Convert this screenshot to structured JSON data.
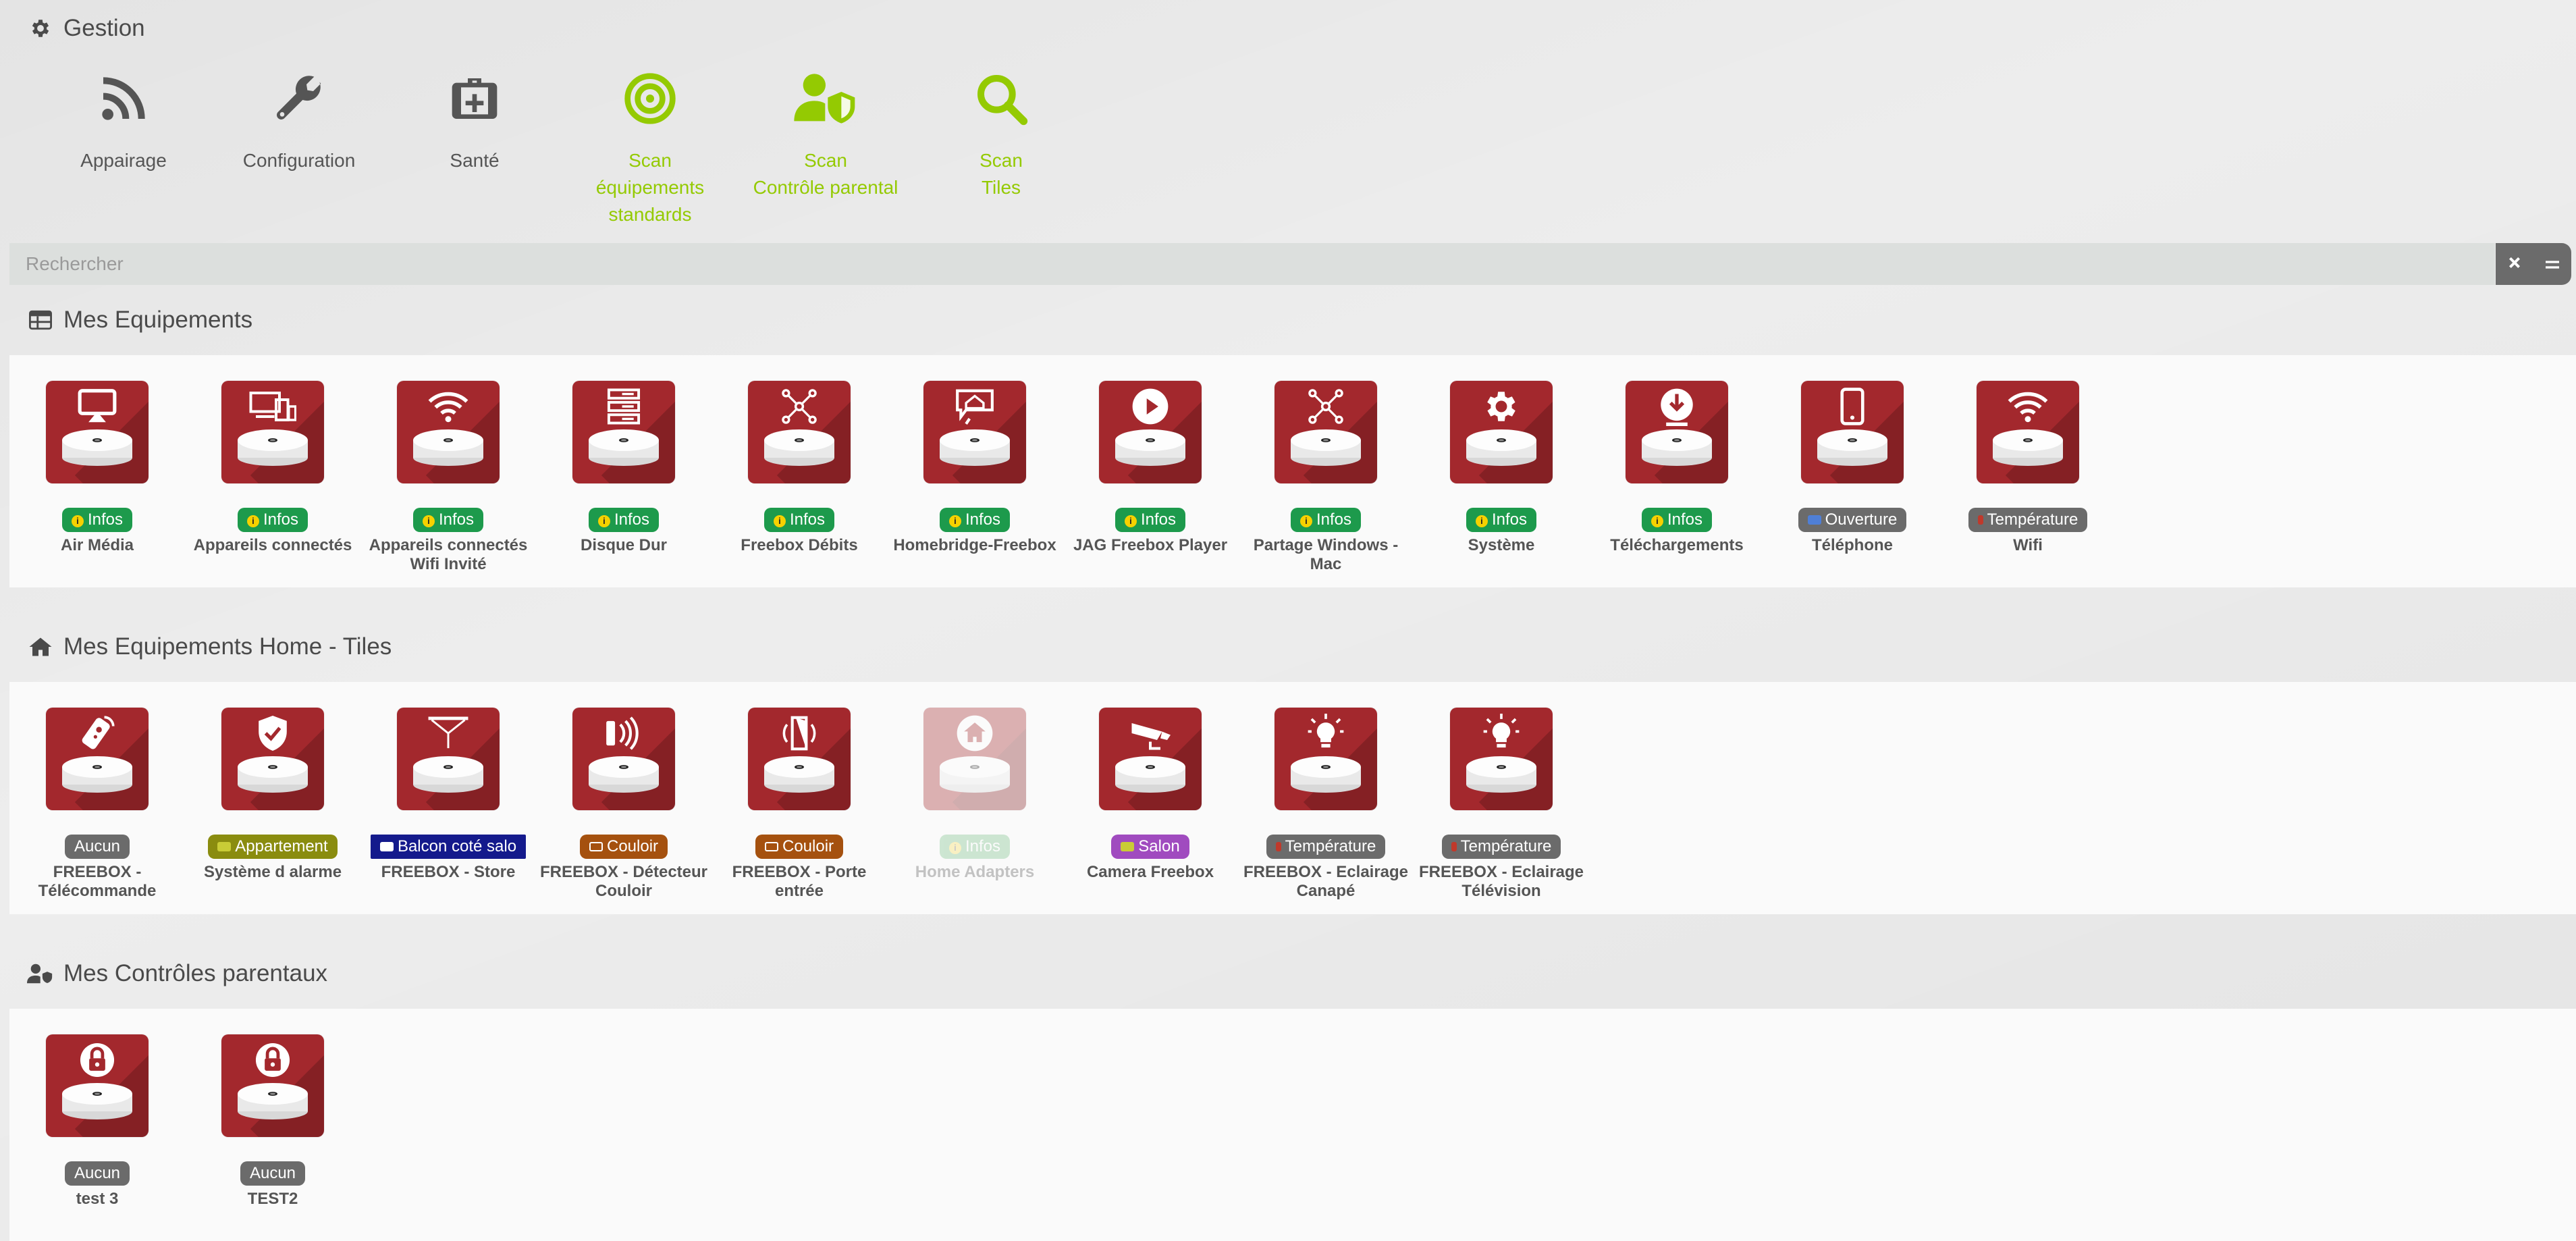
{
  "gestion": {
    "title": "Gestion",
    "tools": [
      {
        "label_lines": [
          "Appairage"
        ],
        "icon": "rss-icon",
        "style": "grey"
      },
      {
        "label_lines": [
          "Configuration"
        ],
        "icon": "wrench-icon",
        "style": "grey"
      },
      {
        "label_lines": [
          "Santé"
        ],
        "icon": "medkit-icon",
        "style": "grey"
      },
      {
        "label_lines": [
          "Scan",
          "équipements",
          "standards"
        ],
        "icon": "target-icon",
        "style": "green"
      },
      {
        "label_lines": [
          "Scan",
          "Contrôle parental"
        ],
        "icon": "user-shield-icon",
        "style": "green"
      },
      {
        "label_lines": [
          "Scan",
          "Tiles"
        ],
        "icon": "search-icon",
        "style": "green"
      }
    ]
  },
  "search": {
    "placeholder": "Rechercher"
  },
  "sections": {
    "equipements": {
      "title": "Mes Equipements"
    },
    "tiles": {
      "title": "Mes Equipements Home - Tiles"
    },
    "parental": {
      "title": "Mes Contrôles parentaux"
    }
  },
  "equipements": [
    {
      "name": "Air Média",
      "badge": "Infos",
      "icon": "airplay-icon"
    },
    {
      "name": "Appareils connectés",
      "badge": "Infos",
      "icon": "devices-icon"
    },
    {
      "name": "Appareils connectés Wifi Invité",
      "badge": "Infos",
      "icon": "wifi-icon"
    },
    {
      "name": "Disque Dur",
      "badge": "Infos",
      "icon": "server-icon"
    },
    {
      "name": "Freebox Débits",
      "badge": "Infos",
      "icon": "network-icon"
    },
    {
      "name": "Homebridge-Freebox",
      "badge": "Infos",
      "icon": "homebridge-icon"
    },
    {
      "name": "JAG Freebox Player",
      "badge": "Infos",
      "icon": "play-icon"
    },
    {
      "name": "Partage Windows - Mac",
      "badge": "Infos",
      "icon": "network-icon"
    },
    {
      "name": "Système",
      "badge": "Infos",
      "icon": "gear-icon"
    },
    {
      "name": "Téléchargements",
      "badge": "Infos",
      "icon": "download-icon"
    },
    {
      "name": "Téléphone",
      "badge": "Ouverture",
      "icon": "phone-icon"
    },
    {
      "name": "Wifi",
      "badge": "Température",
      "icon": "wifi-icon"
    }
  ],
  "tiles": [
    {
      "name": "FREEBOX - Télécommande",
      "badge": "Aucun",
      "icon": "remote-icon"
    },
    {
      "name": "Système d alarme",
      "badge": "Appartement",
      "icon": "shield-check-icon"
    },
    {
      "name": "FREEBOX - Store",
      "badge": "Balcon coté salo",
      "icon": "blind-icon"
    },
    {
      "name": "FREEBOX - Détecteur Couloir",
      "badge": "Couloir",
      "icon": "motion-icon"
    },
    {
      "name": "FREEBOX - Porte entrée",
      "badge": "Couloir",
      "icon": "door-icon"
    },
    {
      "name": "Home Adapters",
      "badge": "Infos",
      "icon": "home-icon"
    },
    {
      "name": "Camera Freebox",
      "badge": "Salon",
      "icon": "camera-icon"
    },
    {
      "name": "FREEBOX - Eclairage Canapé",
      "badge": "Température",
      "icon": "bulb-icon"
    },
    {
      "name": "FREEBOX - Eclairage Télévision",
      "badge": "Température",
      "icon": "bulb-icon"
    }
  ],
  "parental": [
    {
      "name": "test 3",
      "badge": "Aucun",
      "icon": "lock-icon"
    },
    {
      "name": "TEST2",
      "badge": "Aucun",
      "icon": "lock-icon"
    }
  ],
  "colors": {
    "accent_green": "#94ca02",
    "equipment_red": "#a3282d",
    "badge_green": "#1d9a4c",
    "badge_grey": "#6b6b6b"
  }
}
